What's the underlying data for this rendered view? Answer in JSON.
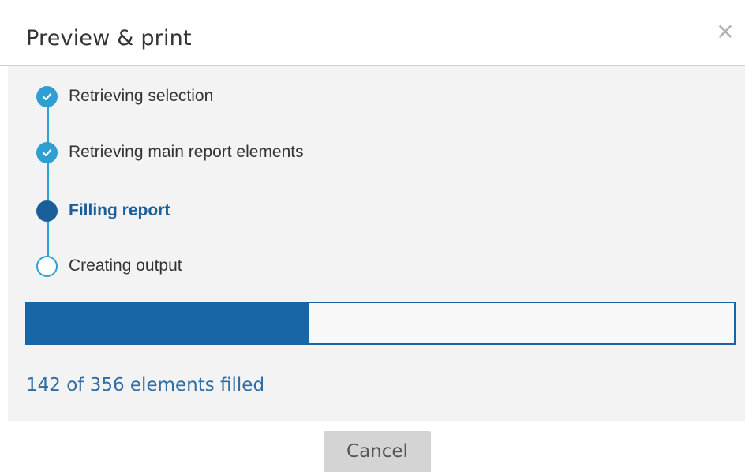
{
  "dialog": {
    "title": "Preview & print",
    "close_icon": "close-icon"
  },
  "steps": [
    {
      "label": "Retrieving selection",
      "status": "done",
      "icon": "check-icon"
    },
    {
      "label": "Retrieving main report elements",
      "status": "done",
      "icon": "check-icon"
    },
    {
      "label": "Filling report",
      "status": "active",
      "icon": "active-dot-icon"
    },
    {
      "label": "Creating output",
      "status": "pending",
      "icon": "empty-circle-icon"
    }
  ],
  "progress": {
    "filled": 142,
    "total": 356,
    "text": "142 of 356 elements filled"
  },
  "footer": {
    "cancel_label": "Cancel"
  },
  "colors": {
    "step_done": "#2d9fd3",
    "step_active": "#1a5e9a",
    "progress_fill": "#1866a5",
    "progress_text": "#2f6da3"
  }
}
